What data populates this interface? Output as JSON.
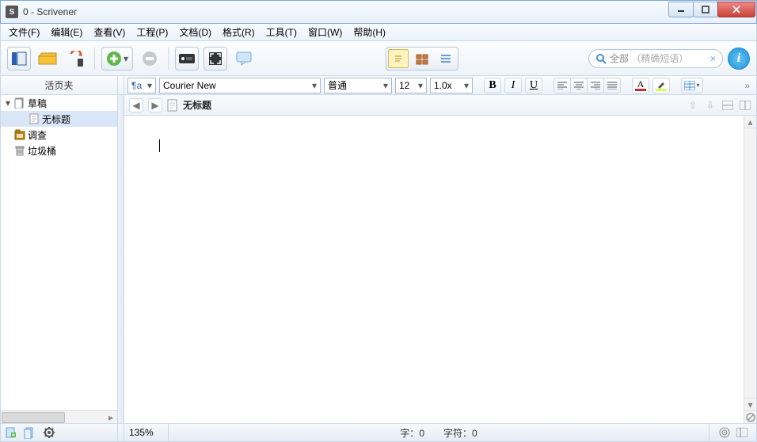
{
  "title": "0 - Scrivener",
  "menu": {
    "file": "文件(F)",
    "edit": "编辑(E)",
    "view": "查看(V)",
    "project": "工程(P)",
    "document": "文档(D)",
    "format": "格式(R)",
    "tools": "工具(T)",
    "window": "窗口(W)",
    "help": "帮助(H)"
  },
  "search": {
    "scope": "全部",
    "placeholder": "（精确短语）"
  },
  "binder": {
    "header": "活页夹",
    "items": [
      {
        "label": "草稿",
        "icon": "draft",
        "expanded": true,
        "depth": 0
      },
      {
        "label": "无标题",
        "icon": "text",
        "depth": 1,
        "selected": true
      },
      {
        "label": "调查",
        "icon": "research",
        "depth": 0
      },
      {
        "label": "垃圾桶",
        "icon": "trash",
        "depth": 0
      }
    ]
  },
  "format_bar": {
    "style": "¶a",
    "font": "Courier New",
    "preset": "普通",
    "size": "12",
    "spacing": "1.0x",
    "bold": "B",
    "italic": "I",
    "underline": "U",
    "text_color": "#c23030",
    "highlight_color": "#d8ff4a"
  },
  "editor": {
    "doc_title": "无标题"
  },
  "status": {
    "zoom": "135%",
    "words_label": "字：",
    "words": "0",
    "chars_label": "字符：",
    "chars": "0"
  }
}
